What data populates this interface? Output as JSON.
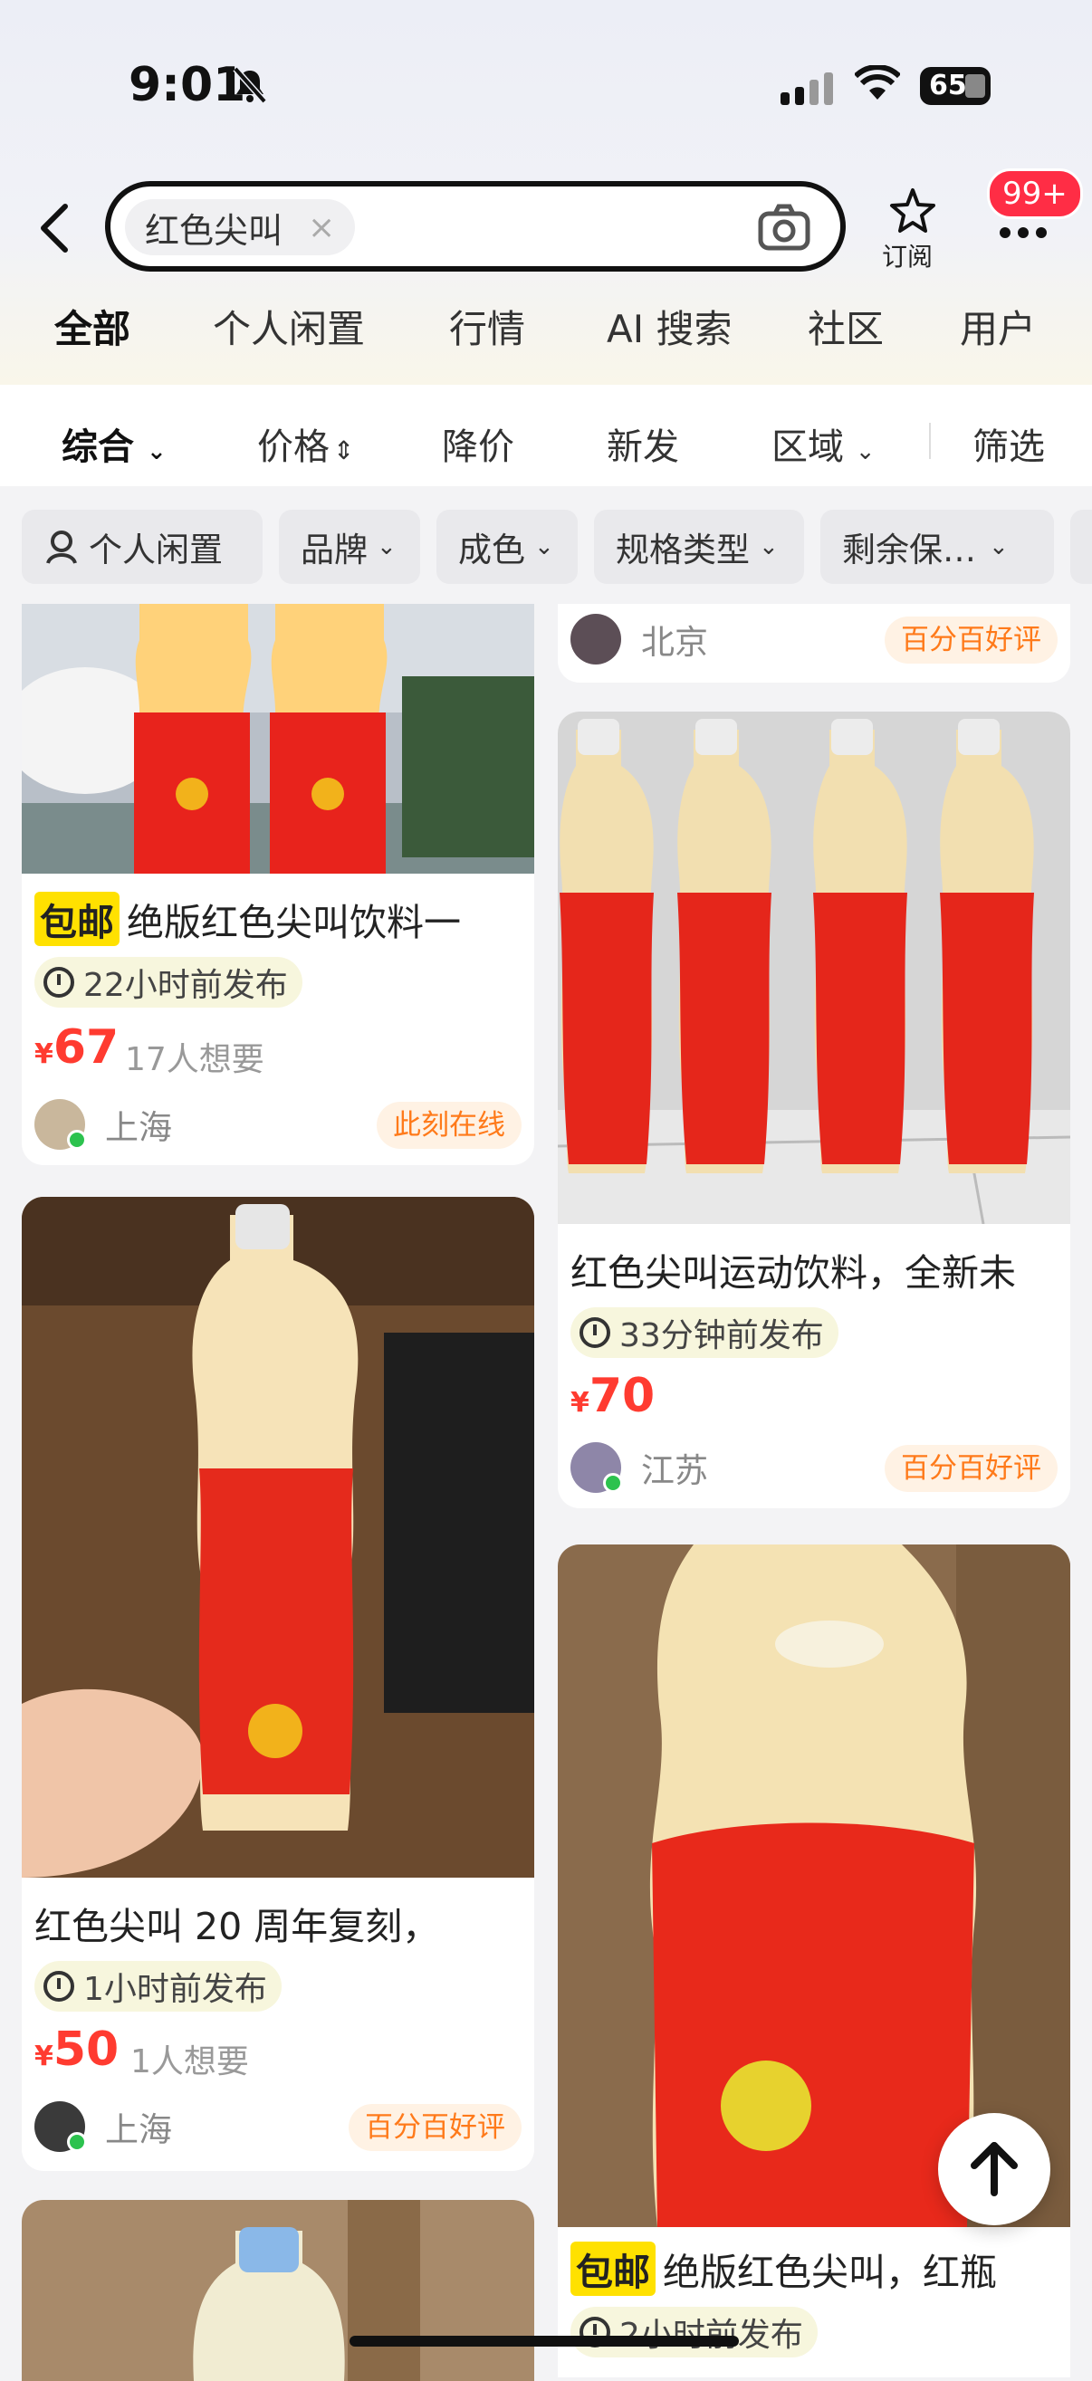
{
  "status": {
    "time": "9:01",
    "battery": "65"
  },
  "search": {
    "query": "红色尖叫",
    "clear": "×"
  },
  "header": {
    "subscribe_label": "订阅",
    "badge": "99+"
  },
  "tabs": [
    {
      "label": "全部",
      "active": true
    },
    {
      "label": "个人闲置"
    },
    {
      "label": "行情"
    },
    {
      "label": "AI 搜索"
    },
    {
      "label": "社区"
    },
    {
      "label": "用户"
    }
  ],
  "sort": {
    "comprehensive": "综合",
    "price": "价格",
    "price_drop": "降价",
    "new": "新发",
    "region": "区域",
    "filter": "筛选"
  },
  "filters": [
    "个人闲置",
    "品牌",
    "成色",
    "规格类型",
    "剩余保…"
  ],
  "left": [
    {
      "title_tag": "包邮",
      "title": "绝版红色尖叫饮料一",
      "time": "22小时前发布",
      "price_symbol": "¥",
      "price": "67",
      "want": "17人想要",
      "city": "上海",
      "badge": "此刻在线"
    },
    {
      "title": "红色尖叫 20 周年复刻，",
      "time": "1小时前发布",
      "price_symbol": "¥",
      "price": "50",
      "want": "1人想要",
      "city": "上海",
      "badge": "百分百好评"
    }
  ],
  "right": [
    {
      "city": "北京",
      "badge": "百分百好评"
    },
    {
      "title": "红色尖叫运动饮料，全新未",
      "time": "33分钟前发布",
      "price_symbol": "¥",
      "price": "70",
      "city": "江苏",
      "badge": "百分百好评"
    },
    {
      "title_tag": "包邮",
      "title": "绝版红色尖叫，红瓶",
      "time": "2小时前发布"
    }
  ],
  "colors": {
    "accent_yellow": "#ffe100",
    "price_red": "#ff3b30",
    "badge_orange": "#ff7a1a",
    "online_green": "#2cc24e"
  }
}
